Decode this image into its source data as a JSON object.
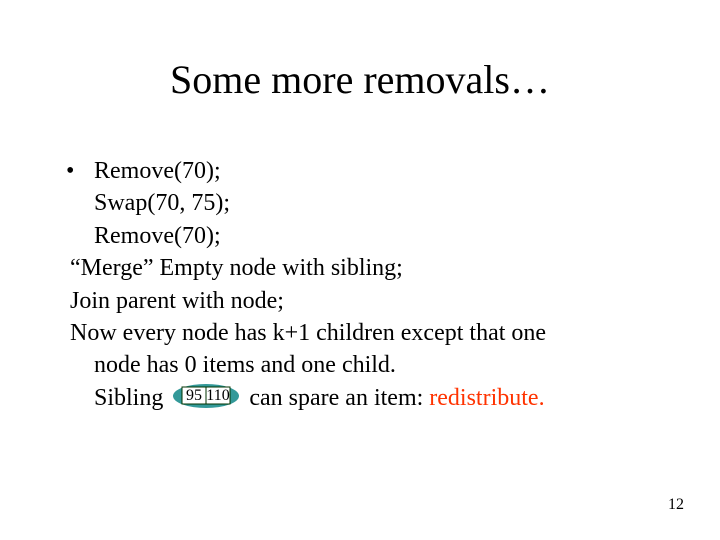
{
  "title": "Some more removals…",
  "lines": {
    "l1": "Remove(70);",
    "l2": "Swap(70, 75);",
    "l3": "Remove(70);",
    "l4": "“Merge” Empty node with sibling;",
    "l5": "Join parent with node;",
    "l6a": "Now every node has k+1 children except that one",
    "l6b": "node has 0 items and one child.",
    "l7a": "Sibling",
    "l7b": " can spare an item: ",
    "l7c": "redistribute."
  },
  "node": {
    "a": "95",
    "b": "110"
  },
  "page_number": "12"
}
